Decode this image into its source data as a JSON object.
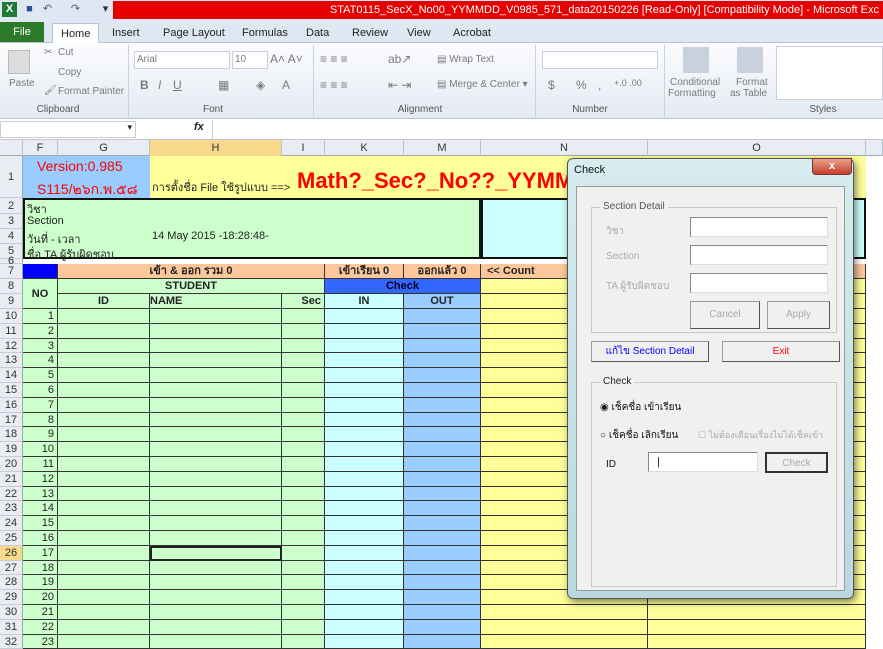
{
  "window": {
    "title": "STAT0115_SecX_No00_YYMMDD_V0985_571_data20150226  [Read-Only]  [Compatibility Mode] - Microsoft Exc"
  },
  "tabs": [
    "File",
    "Home",
    "Insert",
    "Page Layout",
    "Formulas",
    "Data",
    "Review",
    "View",
    "Acrobat"
  ],
  "ribbon": {
    "paste": "Paste",
    "cut": "Cut",
    "copy": "Copy",
    "format_painter": "Format Painter",
    "font_name": "Arial",
    "font_size": "10",
    "wrap_text": "Wrap Text",
    "merge_center": "Merge & Center",
    "conditional": "Conditional",
    "formatting": "Formatting",
    "format": "Format",
    "as_table": "as Table",
    "currency": "$",
    "percent": "%",
    "comma": ",",
    "groups": {
      "clipboard": "Clipboard",
      "font": "Font",
      "alignment": "Alignment",
      "number": "Number",
      "styles": "Styles"
    }
  },
  "formula_bar": {
    "fx": "fx",
    "value": ""
  },
  "columns": [
    "F",
    "G",
    "H",
    "I",
    "K",
    "M",
    "N",
    "O"
  ],
  "sheet": {
    "version": "Version:0.985",
    "code": "S115/๒๖ก.พ.๕๘",
    "naming_hint": "การตั้งชื่อ File ใช้รูปแบบ ==>",
    "naming_pattern": "Math?_Sec?_No??_YYMM",
    "info_labels": [
      "วิชา",
      "Section",
      "วันที่ - เวลา",
      "ชื่อ TA ผู้รับผิดชอบ"
    ],
    "datetime": "14 May 2015 -18:28:48-",
    "total_inout": "เข้า & ออก รวม 0",
    "in_count": "เข้าเรียน 0",
    "out_count": "ออกแล้ว 0",
    "count": "<< Count",
    "no": "NO",
    "student": "STUDENT",
    "check": "Check",
    "id": "ID",
    "name": "NAME",
    "sec": "Sec",
    "in": "IN",
    "out": "OUT",
    "ta_partial": "T",
    "header_rows": [
      "1",
      "2",
      "3",
      "4",
      "5",
      "6",
      "7",
      "8",
      "9"
    ],
    "data_rows": [
      "10",
      "11",
      "12",
      "13",
      "14",
      "15",
      "16",
      "17",
      "18",
      "19",
      "20",
      "21",
      "22",
      "23",
      "24",
      "25",
      "26",
      "27",
      "28",
      "29",
      "30",
      "31",
      "32"
    ],
    "numbers": [
      "1",
      "2",
      "3",
      "4",
      "5",
      "6",
      "7",
      "8",
      "9",
      "10",
      "11",
      "12",
      "13",
      "14",
      "15",
      "16",
      "17",
      "18",
      "19",
      "20",
      "21",
      "22",
      "23"
    ]
  },
  "dialog": {
    "title": "Check",
    "close": "x",
    "section_detail": "Section Detail",
    "subject_label": "วิชา",
    "section_label": "Section",
    "ta_label": "TA ผู้รับผิดชอบ",
    "subject_value": "",
    "section_value": "",
    "ta_value": "",
    "cancel": "Cancel",
    "apply": "Apply",
    "edit_section": "แก้ไข Section Detail",
    "exit": "Exit",
    "check_group": "Check",
    "radio_in": "เช็คชื่อ เข้าเรียน",
    "radio_out": "เช็คชื่อ เลิกเรียน",
    "no_warn": "ไม่ต้องเตือนเรื่องไม่ได้เช็คเข้า",
    "id_label": "ID",
    "id_value": "",
    "check_button": "Check",
    "colors": {
      "edit": "#0000ff",
      "exit": "#ff0000"
    }
  }
}
